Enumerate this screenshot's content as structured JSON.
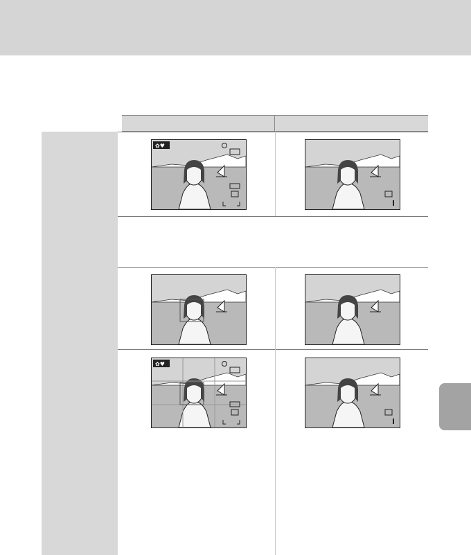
{
  "page": {
    "header_color": "#d5d5d5",
    "side_tab_color": "#a3a3a3"
  },
  "table": {
    "columns": [
      {
        "label": ""
      },
      {
        "label": ""
      }
    ],
    "rows": [
      {
        "label": "",
        "text": "",
        "thumbnails": [
          {
            "icon": "camera-monitor-with-indicators-icon"
          },
          {
            "icon": "camera-monitor-minimal-indicators-icon"
          }
        ]
      },
      {
        "label": "",
        "text": "",
        "thumbnails": []
      },
      {
        "label": "",
        "text": "",
        "thumbnails": [
          {
            "icon": "camera-monitor-no-indicators-icon"
          },
          {
            "icon": "camera-monitor-no-indicators-icon"
          }
        ]
      },
      {
        "label": "",
        "text": "",
        "thumbnails": [
          {
            "icon": "camera-monitor-framing-grid-icon"
          },
          {
            "icon": "camera-monitor-minimal-indicators-icon"
          }
        ]
      }
    ]
  }
}
